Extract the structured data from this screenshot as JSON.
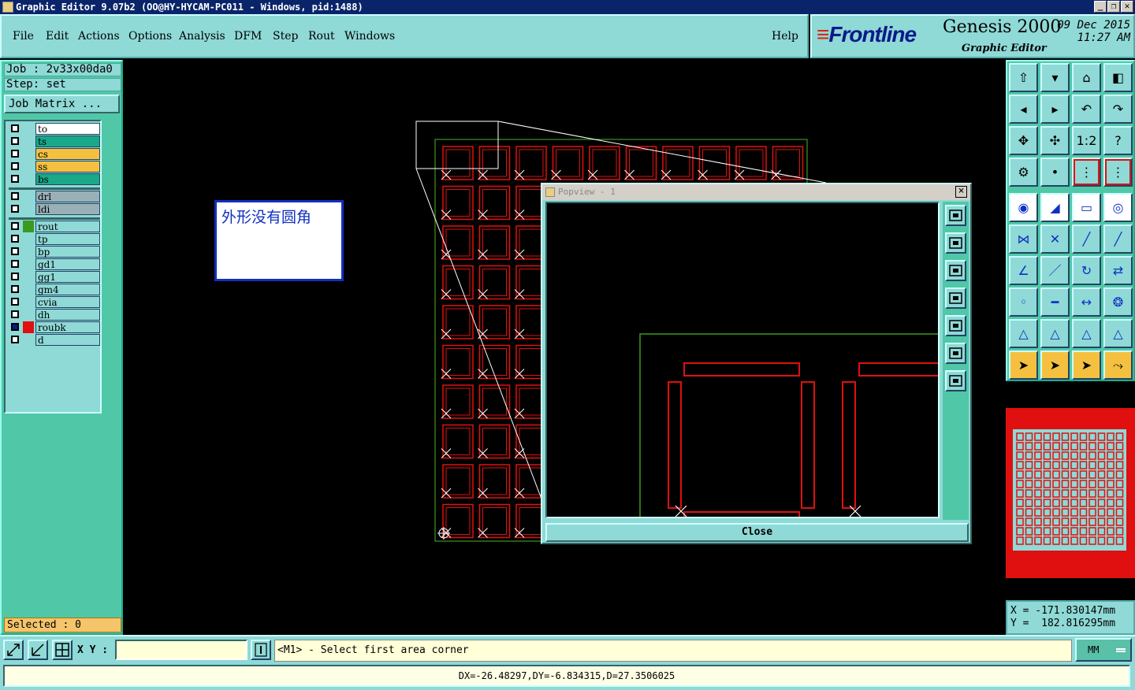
{
  "window": {
    "title": "Graphic Editor 9.07b2 (OO@HY-HYCAM-PC011 - Windows, pid:1488)",
    "controls": [
      "_",
      "❐",
      "✕"
    ]
  },
  "menu": {
    "items": [
      "File",
      "Edit",
      "Actions",
      "Options",
      "Analysis",
      "DFM",
      "Step",
      "Rout",
      "Windows"
    ],
    "help": "Help"
  },
  "brand": {
    "logo": "Frontline",
    "product": "Genesis 2000",
    "subtitle": "Graphic Editor",
    "date": "09 Dec 2015",
    "time": "11:27 AM"
  },
  "job": {
    "job_label": "Job : 2v33x00da0",
    "step_label": "Step: set",
    "matrix_button": "Job Matrix ..."
  },
  "layers": [
    {
      "name": "to",
      "color": "#ffffff",
      "swatch": ""
    },
    {
      "name": "ts",
      "color": "#1aa888",
      "swatch": ""
    },
    {
      "name": "cs",
      "color": "#f5c040",
      "swatch": ""
    },
    {
      "name": "ss",
      "color": "#f5c040",
      "swatch": ""
    },
    {
      "name": "bs",
      "color": "#1aa888",
      "swatch": ""
    },
    {
      "name": "drl",
      "color": "#9ab0b8",
      "swatch": ""
    },
    {
      "name": "ldi",
      "color": "#9ab0b8",
      "swatch": ""
    },
    {
      "name": "rout",
      "color": "#8fd9d6",
      "swatch": "#3a9a20"
    },
    {
      "name": "tp",
      "color": "#8fd9d6",
      "swatch": ""
    },
    {
      "name": "bp",
      "color": "#8fd9d6",
      "swatch": ""
    },
    {
      "name": "gd1",
      "color": "#8fd9d6",
      "swatch": ""
    },
    {
      "name": "gg1",
      "color": "#8fd9d6",
      "swatch": ""
    },
    {
      "name": "gm4",
      "color": "#8fd9d6",
      "swatch": ""
    },
    {
      "name": "cvia",
      "color": "#8fd9d6",
      "swatch": ""
    },
    {
      "name": "dh",
      "color": "#8fd9d6",
      "swatch": ""
    },
    {
      "name": "roubk",
      "color": "#8fd9d6",
      "swatch": "#e01010",
      "active": true
    },
    {
      "name": "d",
      "color": "#8fd9d6",
      "swatch": ""
    }
  ],
  "selected": "Selected : 0",
  "note": {
    "text": "外形没有圆角"
  },
  "popview": {
    "title": "Popview - 1",
    "close_button": "Close"
  },
  "coords": {
    "x": "X = -171.830147mm",
    "y": "Y =  182.816295mm"
  },
  "statusbar": {
    "xy_label": "X Y :",
    "xy_value": "",
    "prompt": "<M1> - Select first area corner",
    "units": "MM",
    "measure": "DX=-26.48297,DY=-6.834315,D=27.3506025"
  },
  "colors": {
    "panel": "#8fd9d6",
    "panel_dark": "#50c8a8",
    "pad": "#e01010",
    "profile": "#3a9a20"
  },
  "icons": {
    "right_tools": [
      "zoom-home-icon",
      "zoom-in-box-icon",
      "home-view-icon",
      "split-view-icon",
      "pan-left-icon",
      "pan-right-icon",
      "undo-icon",
      "redo-icon",
      "fit-screen-icon",
      "zoom-center-icon",
      "ratio-1-2-icon",
      "help-icon",
      "settings-icon",
      "snap-icon",
      "layer-toggle-icon",
      "layer-toggle-2-icon",
      "measure-point-icon",
      "measure-edge-icon",
      "ruler-icon",
      "snap-center-icon",
      "connect-icon",
      "cross-icon",
      "line-point-icon",
      "line-point-2-icon",
      "angle-icon",
      "slope-icon",
      "arc-icon",
      "flip-icon",
      "point-select-icon",
      "dash-icon",
      "distance-icon",
      "group-icon",
      "triangle-icon",
      "triangle-2-icon",
      "triangle-3-icon",
      "triangle-4-icon",
      "pointer-icon",
      "pointer-box-icon",
      "pointer-active-icon",
      "route-icon"
    ]
  }
}
